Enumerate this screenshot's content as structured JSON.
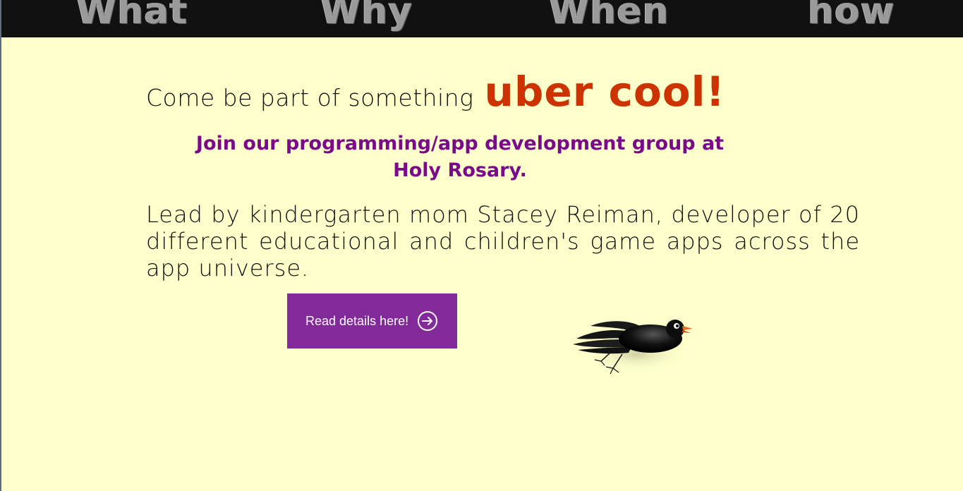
{
  "nav": {
    "items": [
      {
        "label": "What"
      },
      {
        "label": "Why"
      },
      {
        "label": "When"
      },
      {
        "label": "how"
      }
    ]
  },
  "hero": {
    "lead": "Come be part of something",
    "accent": "uber cool!"
  },
  "subhead": "Join our programming/app development group at Holy Rosary.",
  "body": "Lead by kindergarten mom Stacey Reiman, developer of 20 different educational and children's game apps across the app universe.",
  "cta": {
    "label": "Read details here!",
    "icon": "arrow-right-circle-icon"
  },
  "colors": {
    "background": "#ffffcc",
    "navbar": "#111111",
    "accent": "#cc3300",
    "subhead": "#7a0a8a",
    "button": "#822a99"
  }
}
